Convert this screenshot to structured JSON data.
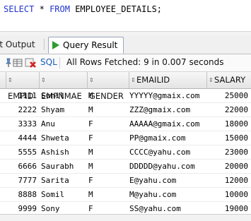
{
  "editor": {
    "kw1": "SELECT",
    "star": "*",
    "kw2": "FROM",
    "table": "EMPLOYEE_DETAILS;"
  },
  "tabs": {
    "script_output": "ot Output",
    "query_result": "Query Result"
  },
  "toolbar": {
    "sql_label": "SQL",
    "status": "All Rows Fetched: 9 in 0.007 seconds"
  },
  "grid": {
    "columns": [
      "EMPID",
      "EMPNMAE",
      "GENDER",
      "EMAILID",
      "SALARY"
    ],
    "rows": [
      [
        "1111",
        "Sunil",
        "M",
        "YYYYY@gmaix.com",
        "25000"
      ],
      [
        "2222",
        "Shyam",
        "M",
        "ZZZ@gmaix.com",
        "22000"
      ],
      [
        "3333",
        "Anu",
        "F",
        "AAAAA@gmaix.com",
        "18000"
      ],
      [
        "4444",
        "Shweta",
        "F",
        "PP@gmaix.com",
        "15000"
      ],
      [
        "5555",
        "Ashish",
        "M",
        "CCCC@yahu.com",
        "23000"
      ],
      [
        "6666",
        "Saurabh",
        "M",
        "DDDDD@yahu.com",
        "20000"
      ],
      [
        "7777",
        "Sarita",
        "F",
        "E@yahu.com",
        "12000"
      ],
      [
        "8888",
        "Somil",
        "M",
        "M@yahu.com",
        "10000"
      ],
      [
        "9999",
        "Sony",
        "F",
        "SS@yahu.com",
        "19000"
      ]
    ]
  },
  "colors": {
    "keyword": "#2233cc",
    "link": "#1a5dbd",
    "play": "#2d9b2d"
  }
}
